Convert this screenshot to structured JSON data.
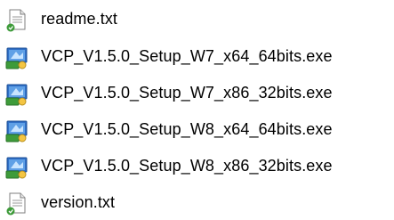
{
  "files": [
    {
      "name": "readme.txt",
      "icon": "text-document-icon"
    },
    {
      "name": "VCP_V1.5.0_Setup_W7_x64_64bits.exe",
      "icon": "installer-icon"
    },
    {
      "name": "VCP_V1.5.0_Setup_W7_x86_32bits.exe",
      "icon": "installer-icon"
    },
    {
      "name": "VCP_V1.5.0_Setup_W8_x64_64bits.exe",
      "icon": "installer-icon"
    },
    {
      "name": "VCP_V1.5.0_Setup_W8_x86_32bits.exe",
      "icon": "installer-icon"
    },
    {
      "name": "version.txt",
      "icon": "text-document-icon"
    }
  ],
  "colors": {
    "text": "#000000",
    "background": "#ffffff",
    "installer_blue": "#2f6fc7",
    "installer_green": "#3e9b3a",
    "doc_border": "#7f7f7f"
  }
}
